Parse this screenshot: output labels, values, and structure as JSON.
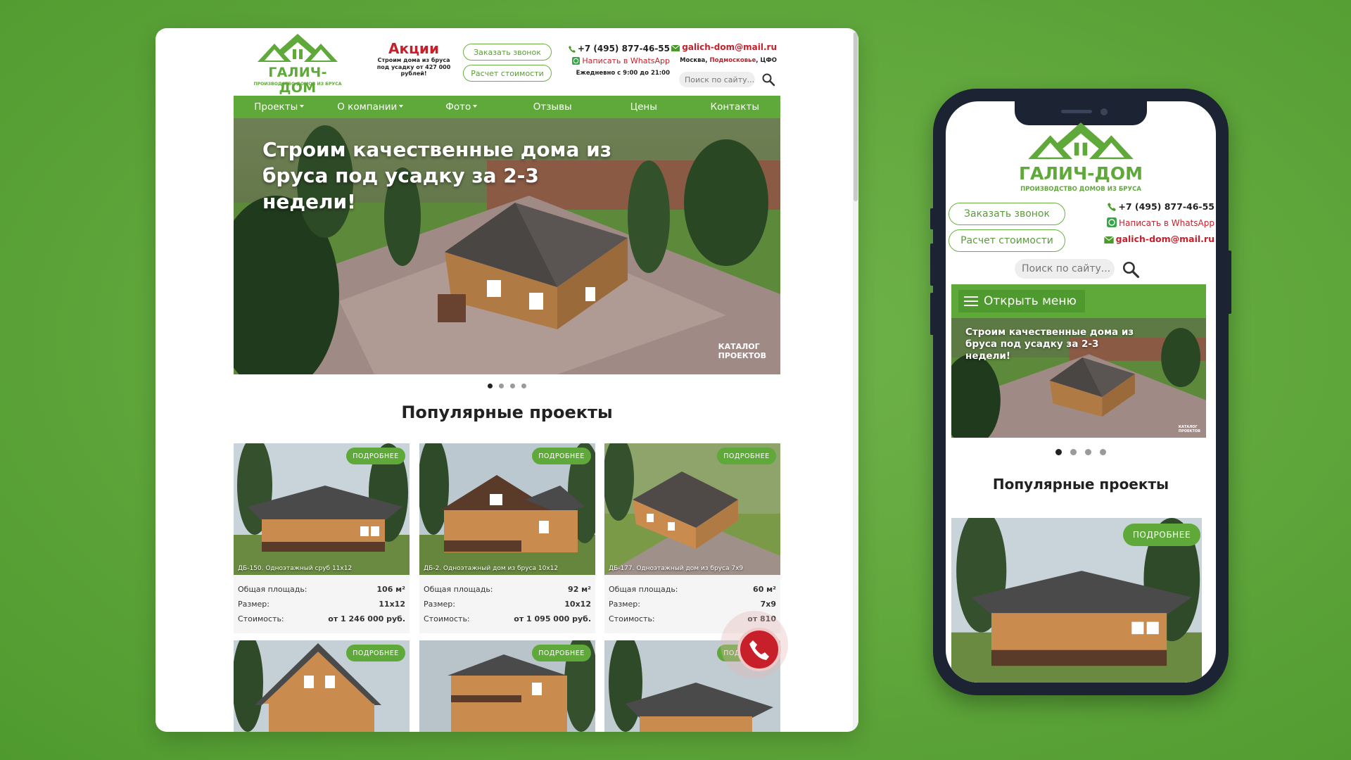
{
  "brand": {
    "name": "ГАЛИЧ-ДОМ",
    "tagline": "ПРОИЗВОДСТВО ДОМОВ ИЗ БРУСА",
    "color": "#5fa83a",
    "accent": "#c8202a"
  },
  "promo": {
    "title": "Акции",
    "text": "Строим дома из бруса под усадку от 427 000 рублей!"
  },
  "buttons": {
    "call": "Заказать звонок",
    "calc": "Расчет стоимости"
  },
  "contacts": {
    "phone": "+7 (495) 877-46-55",
    "whatsapp": "Написать в WhatsApp",
    "hours": "Ежедневно с 9:00 до 21:00",
    "email": "galich-dom@mail.ru",
    "city_a": "Москва, ",
    "city_b": "Подмосковье",
    "city_c": ", ЦФО"
  },
  "search": {
    "placeholder": "Поиск по сайту..."
  },
  "nav": [
    {
      "label": "Проекты",
      "dropdown": true
    },
    {
      "label": "О компании",
      "dropdown": true
    },
    {
      "label": "Фото",
      "dropdown": true
    },
    {
      "label": "Отзывы",
      "dropdown": false
    },
    {
      "label": "Цены",
      "dropdown": false
    },
    {
      "label": "Контакты",
      "dropdown": false
    }
  ],
  "hero": {
    "title": "Строим качественные дома из бруса под усадку за 2-3 недели!",
    "catalog_1": "КАТАЛОГ",
    "catalog_2": "ПРОЕКТОВ",
    "slides": 4,
    "active_slide": 1
  },
  "section_title": "Популярные проекты",
  "card_badge": "ПОДРОБНЕЕ",
  "labels": {
    "area": "Общая площадь:",
    "size": "Размер:",
    "cost": "Стоимость:"
  },
  "projects": [
    {
      "caption": "ДБ-150. Одноэтажный сруб 11x12",
      "area": "106 м²",
      "size": "11x12",
      "cost": "от 1 246 000 руб."
    },
    {
      "caption": "ДБ-2. Одноэтажный дом из бруса 10x12",
      "area": "92 м²",
      "size": "10x12",
      "cost": "от 1 095 000 руб."
    },
    {
      "caption": "ДБ-177. Одноэтажный дом из бруса 7x9",
      "area": "60 м²",
      "size": "7x9",
      "cost": "от 810"
    }
  ],
  "mobile": {
    "menu_label": "Открыть меню",
    "hero_title": "Строим качественные дома из бруса под усадку за 2-3 недели!",
    "catalog_1": "КАТАЛОГ",
    "catalog_2": "ПРОЕКТОВ"
  }
}
